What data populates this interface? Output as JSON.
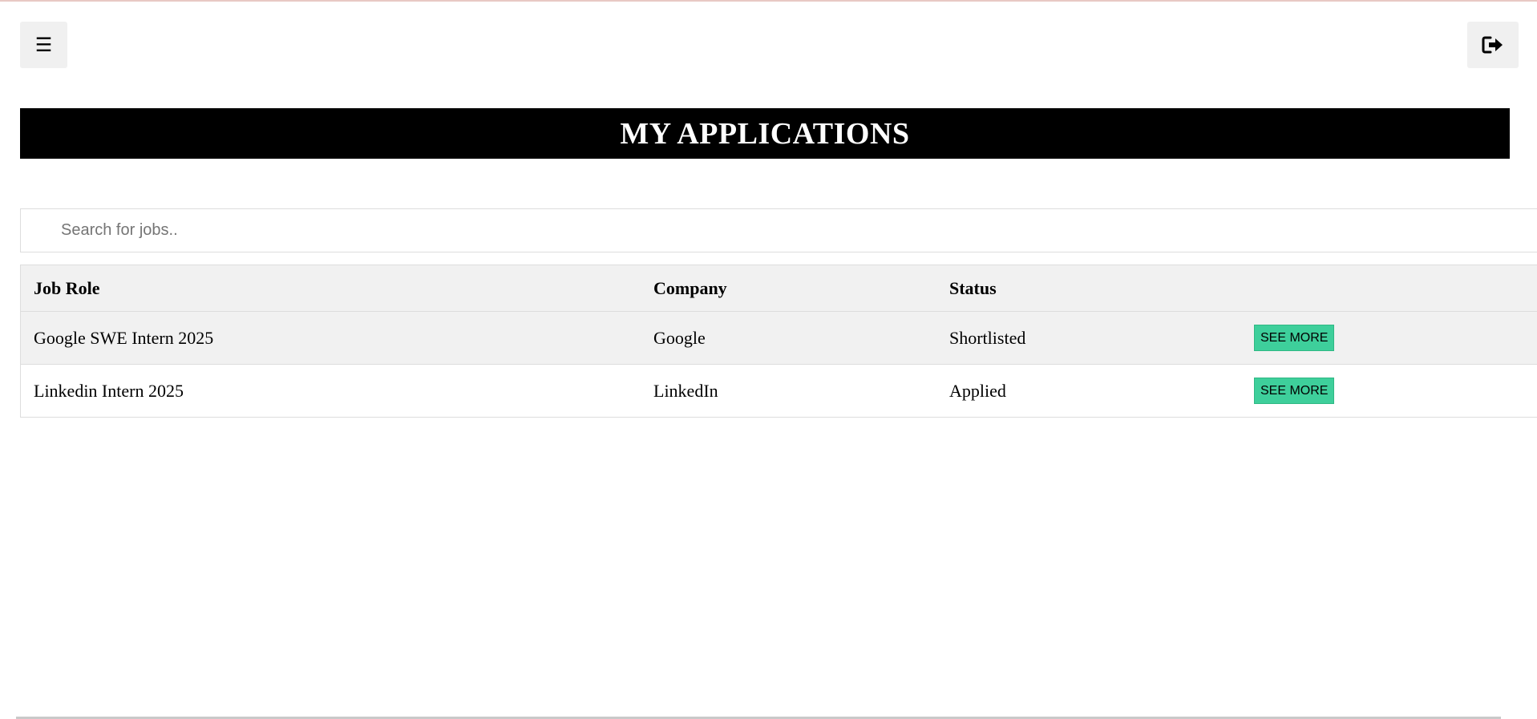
{
  "header": {
    "menu_icon": "☰",
    "logout_icon": "logout-icon"
  },
  "page": {
    "title": "MY APPLICATIONS"
  },
  "search": {
    "placeholder": "Search for jobs.."
  },
  "table": {
    "columns": [
      "Job Role",
      "Company",
      "Status",
      ""
    ],
    "rows": [
      {
        "role": "Google SWE Intern 2025",
        "company": "Google",
        "status": "Shortlisted",
        "action": "SEE MORE"
      },
      {
        "role": "Linkedin Intern 2025",
        "company": "LinkedIn",
        "status": "Applied",
        "action": "SEE MORE"
      }
    ]
  },
  "colors": {
    "title_bg": "#000000",
    "button_accent": "#3ecf9b",
    "header_row_bg": "#f1f1f1"
  }
}
